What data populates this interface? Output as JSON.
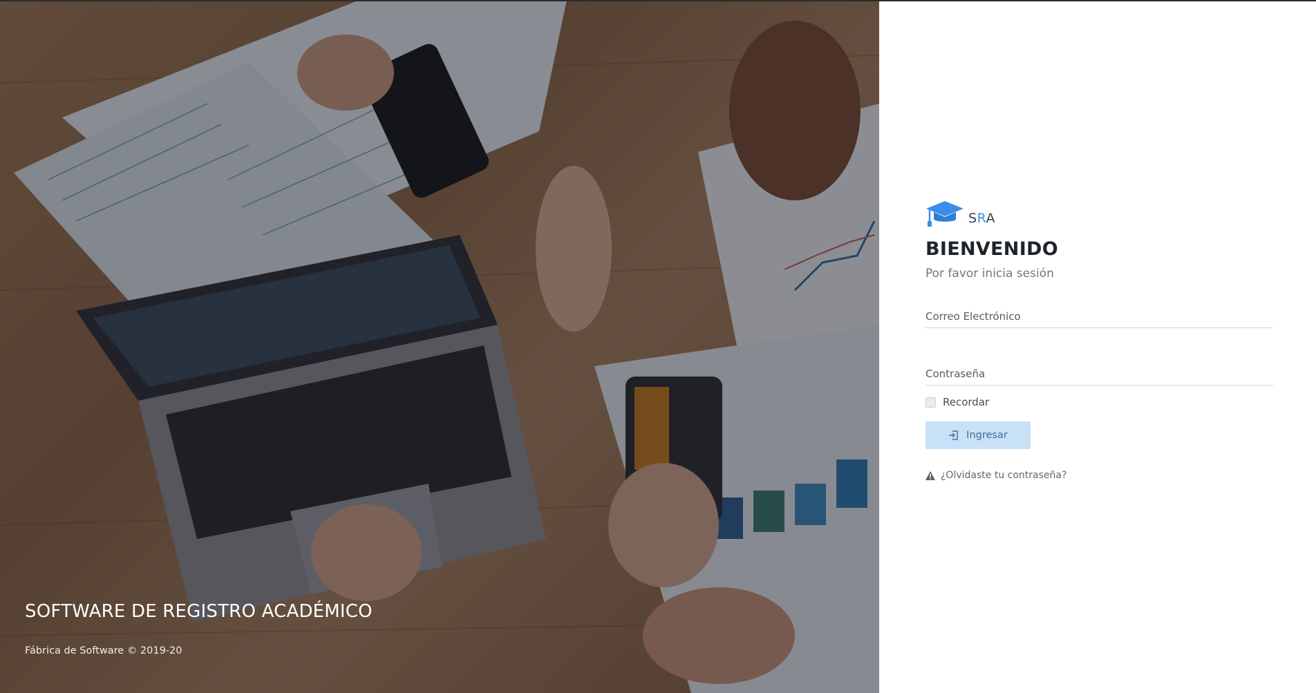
{
  "hero": {
    "title": "SOFTWARE DE REGISTRO ACADÉMICO",
    "footer": "Fábrica de Software © 2019-20",
    "image_icon": "team-desk-laptop-photo"
  },
  "brand": {
    "logo_icon": "graduation-cap-icon",
    "name_prefix": "S",
    "name_accent": "R",
    "name_suffix": "A",
    "accent_color": "#3a8ee6"
  },
  "login": {
    "heading": "BIENVENIDO",
    "subtitle": "Por favor inicia sesión",
    "email_placeholder": "Correo Electrónico",
    "password_placeholder": "Contraseña",
    "remember_label": "Recordar",
    "submit_label": "Ingresar",
    "submit_icon": "sign-in-icon",
    "forgot_label": "¿Olvidaste tu contraseña?",
    "forgot_icon": "warning-icon"
  },
  "colors": {
    "button_bg": "#c9e1f7",
    "button_text": "#3e6c97"
  }
}
